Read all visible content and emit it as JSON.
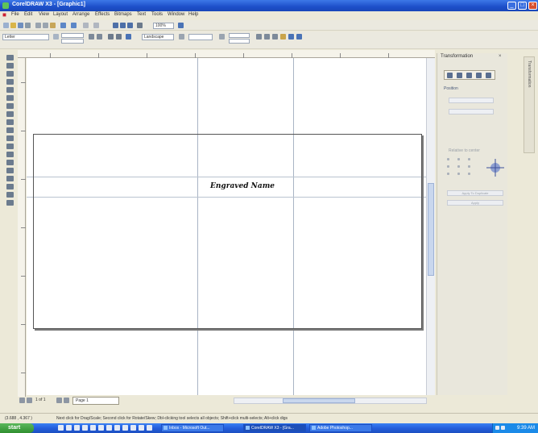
{
  "window": {
    "title": "CorelDRAW X3 - [Graphic1]",
    "buttons": [
      "minimize",
      "maximize",
      "close"
    ]
  },
  "menu": {
    "items": [
      {
        "id": "file",
        "label": "File"
      },
      {
        "id": "edit",
        "label": "Edit"
      },
      {
        "id": "view",
        "label": "View"
      },
      {
        "id": "layout",
        "label": "Layout"
      },
      {
        "id": "arrange",
        "label": "Arrange"
      },
      {
        "id": "effects",
        "label": "Effects"
      },
      {
        "id": "bitmaps",
        "label": "Bitmaps"
      },
      {
        "id": "text",
        "label": "Text"
      },
      {
        "id": "tools",
        "label": "Tools"
      },
      {
        "id": "window",
        "label": "Window"
      },
      {
        "id": "help",
        "label": "Help"
      }
    ]
  },
  "standard_toolbar": {
    "zoom_value": "100%"
  },
  "property_bar": {
    "font_name": "Letter",
    "style_value": "Landscape",
    "units_value": "inches"
  },
  "canvas": {
    "text_object": "Engraved Name"
  },
  "docker": {
    "title": "Transformation",
    "section_position": "Position",
    "relative_label": "Relative to center",
    "apply_to_duplicate": "Apply To Duplicate",
    "apply": "Apply"
  },
  "docker_tabs": [
    "Transformation"
  ],
  "page_nav": {
    "page_count": "1 of 1",
    "tab_label": "Page 1"
  },
  "statusbar": {
    "coords": "(3.688 , 4.367 )",
    "hint": "Next click for Drag/Scale; Second click for Rotate/Skew; Dbl-clicking tool selects all objects; Shift+click multi-selects; Alt+click digs"
  },
  "taskbar": {
    "start_label": "start",
    "items": [
      {
        "label": "Inbox - Microsoft Out..."
      },
      {
        "label": "CorelDRAW X3 - [Gra..."
      },
      {
        "label": "Adobe Photoshop..."
      }
    ],
    "clock": "9:39 AM"
  },
  "colors": {
    "title_bar": "#1c4fc9",
    "taskbar": "#245edc",
    "start_button": "#3c9b3c",
    "guide_line": "#a9b4c4"
  }
}
